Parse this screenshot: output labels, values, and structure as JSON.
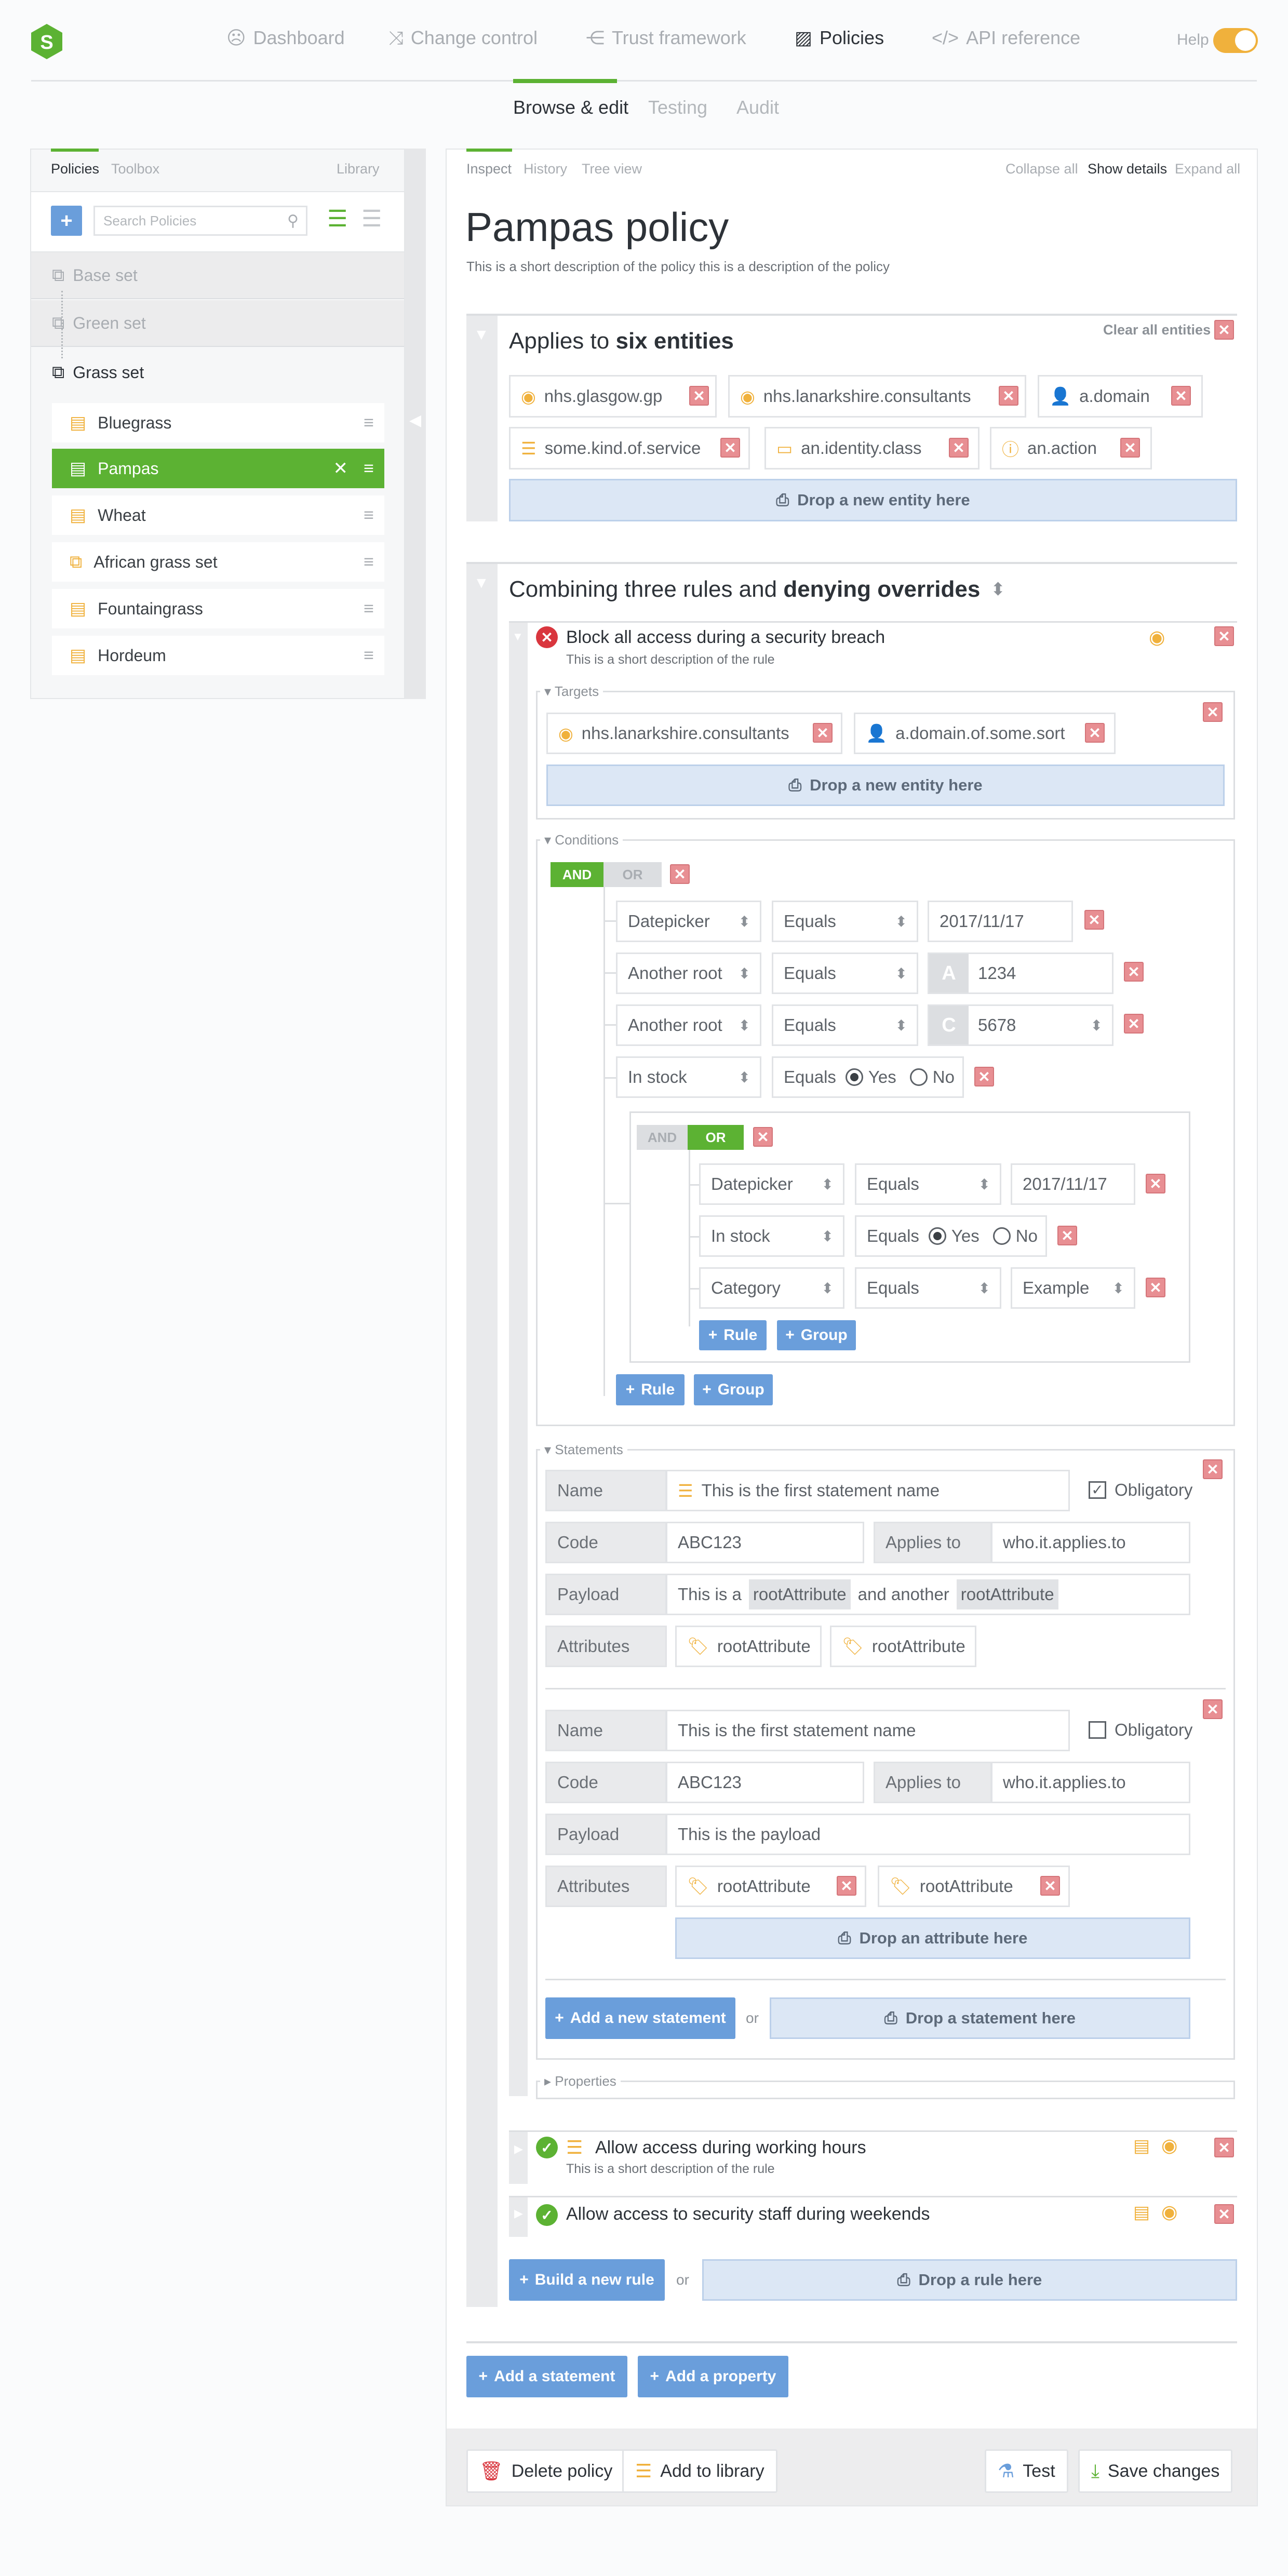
{
  "nav": {
    "items": [
      {
        "label": "Dashboard",
        "icon": "smiley-icon"
      },
      {
        "label": "Change control",
        "icon": "shuffle-icon"
      },
      {
        "label": "Trust framework",
        "icon": "share-icon"
      },
      {
        "label": "Policies",
        "icon": "policy-icon"
      },
      {
        "label": "API reference",
        "icon": "code-icon"
      }
    ],
    "help": "Help"
  },
  "subnav": [
    "Browse & edit",
    "Testing",
    "Audit"
  ],
  "sidebar": {
    "tabs": [
      "Policies",
      "Toolbox"
    ],
    "library": "Library",
    "search_placeholder": "Search Policies",
    "sets": [
      "Base set",
      "Green set",
      "Grass set"
    ],
    "items": [
      "Bluegrass",
      "Pampas",
      "Wheat",
      "African grass set",
      "Fountaingrass",
      "Hordeum"
    ]
  },
  "toolbar": {
    "left": [
      "Inspect",
      "History",
      "Tree view"
    ],
    "right": [
      "Collapse all",
      "Show details",
      "Expand all"
    ]
  },
  "policy": {
    "title": "Pampas policy",
    "description": "This is a short description of the policy this is a description of the policy"
  },
  "entities": {
    "heading_pre": "Applies to ",
    "heading_bold": "six entities",
    "clear_all": "Clear all entities",
    "items": [
      "nhs.glasgow.gp",
      "nhs.lanarkshire.consultants",
      "a.domain",
      "some.kind.of.service",
      "an.identity.class",
      "an.action"
    ],
    "drop": "Drop a new entity here"
  },
  "rules": {
    "heading_pre": "Combining three rules and ",
    "heading_bold": "denying overrides",
    "rule1": {
      "title": "Block all access during a security breach",
      "description": "This is a short description of the rule",
      "targets_label": "Targets",
      "targets": [
        "nhs.lanarkshire.consultants",
        "a.domain.of.some.sort"
      ],
      "drop": "Drop a new entity here",
      "conditions_label": "Conditions",
      "and": "AND",
      "or": "OR",
      "conditions": [
        {
          "field": "Datepicker",
          "op": "Equals",
          "value": "2017/11/17"
        },
        {
          "field": "Another root",
          "op": "Equals",
          "badge": "A",
          "value": "1234"
        },
        {
          "field": "Another root",
          "op": "Equals",
          "badge": "C",
          "value": "5678"
        },
        {
          "field": "In stock",
          "op": "Equals",
          "yes": "Yes",
          "no": "No"
        }
      ],
      "group": [
        {
          "field": "Datepicker",
          "op": "Equals",
          "value": "2017/11/17"
        },
        {
          "field": "In stock",
          "op": "Equals",
          "yes": "Yes",
          "no": "No"
        },
        {
          "field": "Category",
          "op": "Equals",
          "value": "Example"
        }
      ],
      "add_rule": "Rule",
      "add_group": "Group",
      "statements_label": "Statements",
      "statement1": {
        "name_label": "Name",
        "name": "This is the first statement name",
        "obligatory": "Obligatory",
        "code_label": "Code",
        "code": "ABC123",
        "applies_label": "Applies to",
        "applies": "who.it.applies.to",
        "payload_label": "Payload",
        "payload_a": "This is a",
        "payload_attr1": "rootAttribute",
        "payload_b": "and another",
        "payload_attr2": "rootAttribute",
        "attributes_label": "Attributes",
        "attributes": [
          "rootAttribute",
          "rootAttribute"
        ]
      },
      "statement2": {
        "name_label": "Name",
        "name": "This is the first statement name",
        "obligatory": "Obligatory",
        "code_label": "Code",
        "code": "ABC123",
        "applies_label": "Applies to",
        "applies": "who.it.applies.to",
        "payload_label": "Payload",
        "payload": "This is the payload",
        "attributes_label": "Attributes",
        "attributes": [
          "rootAttribute",
          "rootAttribute"
        ],
        "drop_attr": "Drop an attribute here"
      },
      "add_statement": "Add a new statement",
      "or_word": "or",
      "drop_statement": "Drop a statement here",
      "properties_label": "Properties"
    },
    "rule2": {
      "title": "Allow access during working hours",
      "description": "This is a short description of the rule"
    },
    "rule3": {
      "title": "Allow access to security staff during weekends"
    },
    "build_rule": "Build a new rule",
    "or_word": "or",
    "drop_rule": "Drop a rule here"
  },
  "footer_actions": {
    "add_statement": "Add a statement",
    "add_property": "Add a property"
  },
  "bottom": {
    "delete": "Delete policy",
    "library": "Add to library",
    "test": "Test",
    "save": "Save changes"
  },
  "colors": {
    "accent_green": "#5cb233",
    "primary_blue": "#6a9edb",
    "danger_red": "#e88f93",
    "warn_orange": "#f0b13c"
  }
}
